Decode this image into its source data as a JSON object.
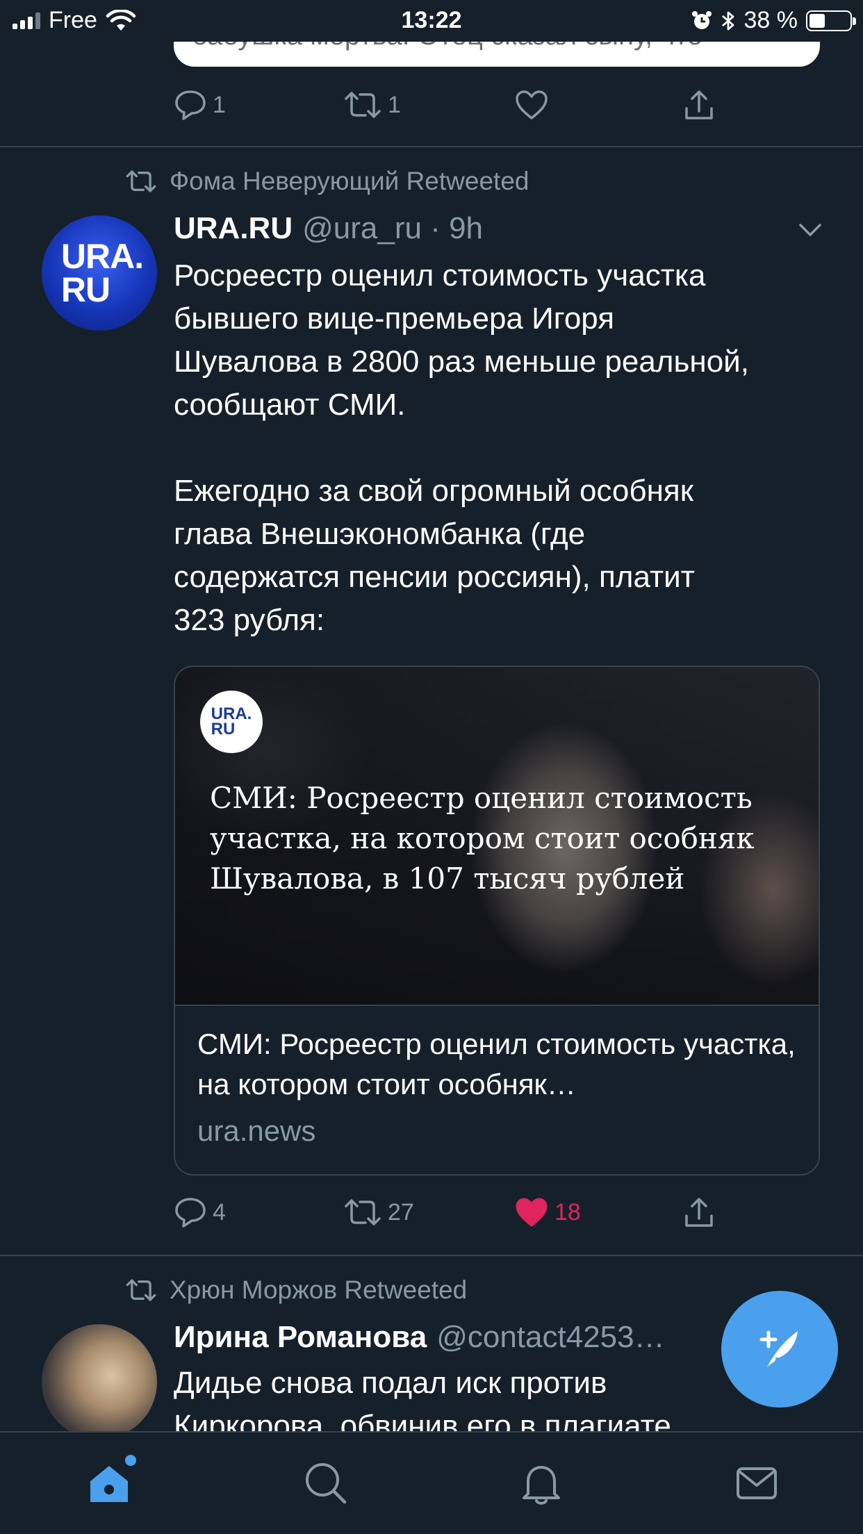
{
  "status_bar": {
    "carrier": "Free",
    "time": "13:22",
    "battery": "38 %"
  },
  "previous_tweet": {
    "card_text": "бабушка мертва. Отец сказал сыну, что",
    "replies": "1",
    "retweets": "1"
  },
  "tweets": [
    {
      "retweeted_by": "Фома Неверующий Retweeted",
      "name": "URA.RU",
      "handle": "@ura_ru · 9h",
      "avatar_text": "URA.\nRU",
      "text": "Росреестр оценил стоимость участка\nбывшего вице-премьера Игоря\nШувалова в 2800 раз меньше реальной,\nсообщают СМИ.\n\nЕжегодно за свой огромный особняк\nглава Внешэкономбанка (где\nсодержатся пенсии россиян), платит\n323 рубля:",
      "card": {
        "logo_text": "URA.\nRU",
        "image_headline": "СМИ: Росреестр оценил стоимость участка, на котором стоит особняк Шувалова, в 107 тысяч рублей",
        "title": "СМИ: Росреестр оценил стоимость участка, на котором стоит особняк…",
        "domain": "ura.news"
      },
      "replies": "4",
      "retweets": "27",
      "likes": "18",
      "liked": true
    },
    {
      "retweeted_by": "Хрюн Моржов Retweeted",
      "name": "Ирина Романова",
      "handle": "@contact4253…",
      "text": "Дидье снова подал иск против\nКиркорова, обвинив его в плагиате"
    }
  ],
  "icons": {
    "reply": "reply-icon",
    "retweet": "retweet-icon",
    "like": "heart-icon",
    "share": "share-icon",
    "compose": "compose-tweet-icon",
    "home": "home-icon",
    "search": "search-icon",
    "notifications": "bell-icon",
    "messages": "mail-icon"
  },
  "colors": {
    "background": "#15202b",
    "accent": "#4aa0ec",
    "muted": "#8899a6",
    "like": "#e0245e",
    "divider": "#38444d"
  }
}
